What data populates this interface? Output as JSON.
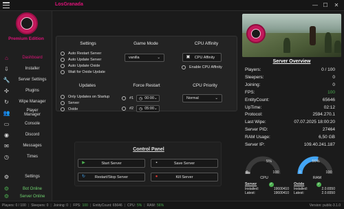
{
  "app": {
    "title": "LosGranada"
  },
  "window": {
    "minimize": "—",
    "maximize": "☐",
    "close": "✕"
  },
  "sidebar": {
    "edition": "Premium Edition",
    "items": [
      {
        "label": "Dashboard",
        "icon": "house-icon",
        "glyph": "⌂",
        "active": true
      },
      {
        "label": "Installer",
        "icon": "install-icon",
        "glyph": "⇩",
        "active": false
      },
      {
        "label": "Server Settings",
        "icon": "wrench-icon",
        "glyph": "🔧",
        "active": false
      },
      {
        "label": "Plugins",
        "icon": "plug-icon",
        "glyph": "✣",
        "active": false
      },
      {
        "label": "Wipe Manager",
        "icon": "wipe-icon",
        "glyph": "↻",
        "active": false
      },
      {
        "label": "Player Manager",
        "icon": "people-icon",
        "glyph": "👥",
        "active": false
      },
      {
        "label": "Console",
        "icon": "terminal-icon",
        "glyph": "▭",
        "active": false
      },
      {
        "label": "Discord",
        "icon": "discord-icon",
        "glyph": "◉",
        "active": false
      },
      {
        "label": "Messages",
        "icon": "message-icon",
        "glyph": "✉",
        "active": false
      },
      {
        "label": "Times",
        "icon": "clock-icon",
        "glyph": "◷",
        "active": false
      }
    ],
    "settings": {
      "label": "Settings",
      "icon": "gear-icon",
      "glyph": "⚙"
    },
    "bot_status": "Bot Online",
    "server_status": "Server Online",
    "status_color": "#4caf50",
    "accent": "#e0137a"
  },
  "settings_panel": {
    "settings_title": "Settings",
    "game_mode_title": "Game Mode",
    "cpu_affinity_title": "CPU Affinity",
    "options": [
      "Auto Restart Server",
      "Auto Update Server",
      "Auto Update Oxide",
      "Wait for Oxide Update"
    ],
    "game_mode_value": "vanilla",
    "cpu_affinity_button": "CPU Affinity",
    "enable_cpu_affinity": "Enable CPU Affinity",
    "updates_title": "Updates",
    "force_restart_title": "Force Restart",
    "cpu_priority_title": "CPU Priority",
    "update_options": [
      "Only Updates on Startup",
      "Server",
      "Oxide"
    ],
    "restart_1_label": "#1",
    "restart_1_time": "00:00",
    "restart_2_label": "#2",
    "restart_2_time": "05:00",
    "cpu_priority_value": "Normal"
  },
  "control_panel": {
    "title": "Control Panel",
    "start": "Start Server",
    "save": "Save Server",
    "restart_stop": "Restart/Stop Server",
    "kill": "Kill Server"
  },
  "overview": {
    "title": "Server Overview",
    "stats": [
      {
        "label": "Players:",
        "value": "0 / 100",
        "green": false
      },
      {
        "label": "Sleepers:",
        "value": "0",
        "green": false
      },
      {
        "label": "Joining:",
        "value": "0",
        "green": false
      },
      {
        "label": "FPS:",
        "value": "100",
        "green": true
      },
      {
        "label": "EntityCount:",
        "value": "65646",
        "green": false
      },
      {
        "label": "UpTime:",
        "value": "02:12",
        "green": false
      },
      {
        "label": "Protocol:",
        "value": "2594.270.1",
        "green": false
      },
      {
        "label": "Last Wipe:",
        "value": "07.07.2025 18:00:20",
        "green": false
      },
      {
        "label": "Server PID:",
        "value": "27464",
        "green": false
      },
      {
        "label": "RAM Usage:",
        "value": "6,50 GB",
        "green": false
      },
      {
        "label": "Server IP:",
        "value": "109.40.241.187",
        "green": false
      }
    ],
    "cpu": {
      "label": "CPU",
      "percent_text": "5%",
      "percent": 5,
      "min": "0",
      "max": "100",
      "color": "#9e9e9e"
    },
    "ram": {
      "label": "RAM",
      "percent_text": "56%",
      "percent": 56,
      "min": "0",
      "max": "100",
      "color": "#42a5f5"
    },
    "server_versions": {
      "title": "Server",
      "installed_label": "Installed:",
      "installed": "19600410",
      "latest_label": "Latest:",
      "latest": "19600410"
    },
    "oxide_versions": {
      "title": "Oxide",
      "installed_label": "Installed:",
      "installed": "2.0.6550",
      "latest_label": "Latest:",
      "latest": "2.0.6550"
    }
  },
  "statusbar": {
    "players": "Players: 0 / 100",
    "sleepers": "Sleepers: 0",
    "joining": "Joining: 0",
    "fps_label": "FPS:",
    "fps": "100",
    "entity": "EntityCount: 65646",
    "cpu_label": "CPU:",
    "cpu": "5%",
    "ram_label": "RAM:",
    "ram": "56%",
    "version": "Version: public-3.1.0"
  }
}
